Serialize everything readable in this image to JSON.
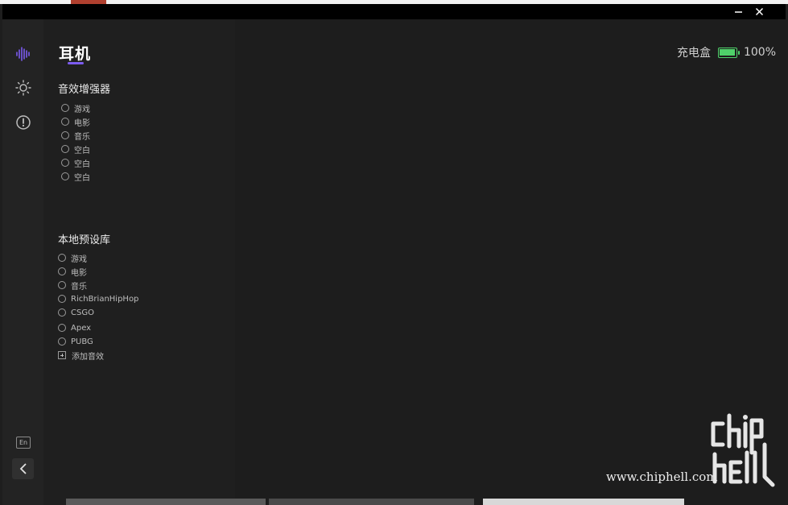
{
  "window": {
    "minimize_icon": "minimize-icon",
    "close_icon": "close-icon"
  },
  "sidebar": {
    "items": [
      {
        "icon": "sound-wave-icon",
        "active": true
      },
      {
        "icon": "sun-icon",
        "active": false
      },
      {
        "icon": "alert-circle-icon",
        "active": false
      }
    ],
    "language_label": "En",
    "back_icon": "chevron-left-icon"
  },
  "header": {
    "title": "耳机",
    "battery_label": "充电盒",
    "battery_percent": "100%",
    "battery_level": 1.0
  },
  "enhancer": {
    "title": "音效增强器",
    "options": [
      "游戏",
      "电影",
      "音乐",
      "空白",
      "空白",
      "空白"
    ]
  },
  "presets": {
    "title": "本地预设库",
    "options": [
      "游戏",
      "电影",
      "音乐",
      "RichBrianHipHop",
      "CSGO",
      "Apex",
      "PUBG"
    ],
    "add_label": "添加音效"
  },
  "watermark": {
    "url": "www.chiphell.com"
  },
  "colors": {
    "accent": "#7c5cf0",
    "battery": "#4fd16a"
  }
}
